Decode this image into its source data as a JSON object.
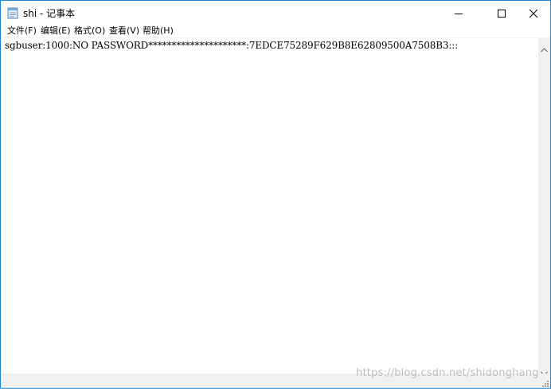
{
  "window": {
    "title": "shi - 记事本",
    "accent_color": "#1883d7",
    "icons": {
      "app": "notepad-icon",
      "minimize": "minimize-icon",
      "maximize": "maximize-icon",
      "close": "close-icon"
    }
  },
  "menu": {
    "items": [
      {
        "label": "文件(F)"
      },
      {
        "label": "编辑(E)"
      },
      {
        "label": "格式(O)"
      },
      {
        "label": "查看(V)"
      },
      {
        "label": "帮助(H)"
      }
    ]
  },
  "editor": {
    "content": "sgbuser:1000:NO PASSWORD*********************:7EDCE75289F629B8E62809500A7508B3:::"
  },
  "watermark": {
    "text": "https://blog.csdn.net/shidonghang"
  }
}
